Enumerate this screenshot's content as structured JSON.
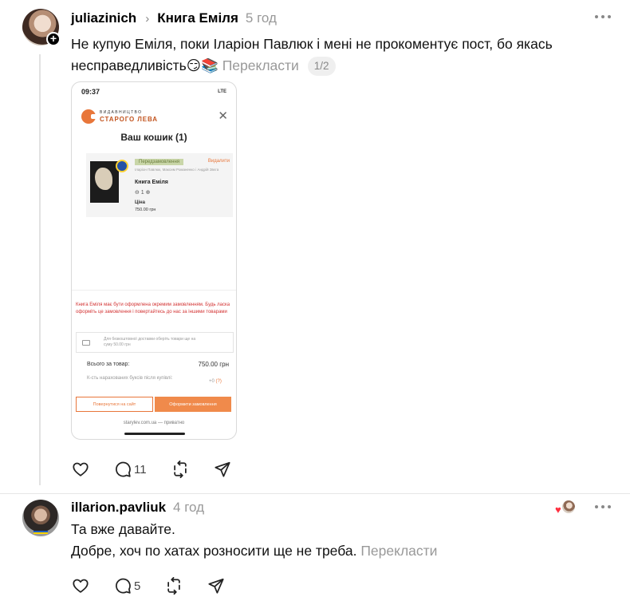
{
  "post1": {
    "username": "juliazinich",
    "topic": "Книга Еміля",
    "time": "5 год",
    "text": "Не купую Еміля, поки Іларіон Павлюк і мені не прокоментує пост, бо якась несправедливість😏📚",
    "translate": "Перекласти",
    "pager": "1/2",
    "replies": "11",
    "screenshot": {
      "status_time": "09:37",
      "status_right": "LTE",
      "brand_top": "ВИДАВНИЦТВО",
      "brand_bottom": "СТАРОГО ЛЕВА",
      "cart_title": "Ваш кошик (1)",
      "tag": "Передзамовлення",
      "delete": "Видалити",
      "authors": "Іларіон Павлюк, Максим Романенко і Андрій Звєга",
      "book": "Книга Еміля",
      "qty": "⊖ 1 ⊕",
      "price_label": "Ціна",
      "price": "750.00 грн",
      "warning": "Книга Еміля має бути оформлена окремим замовленням. Будь ласка оформіть це замовлення і повертайтесь до нас за іншими товарами",
      "delivery": "Для безкоштовної доставки оберіть товари ще на суму 50.00 грн",
      "total_label": "Всього за товар:",
      "total": "750.00 грн",
      "bonus_label": "К-сть нарахованих буксів після купівлі:",
      "bonus_value": "+0",
      "bonus_help": "(?)",
      "back_button": "Повернутися на сайт",
      "order_button": "Оформити замовлення",
      "url": "starylev.com.ua — приватно"
    }
  },
  "post2": {
    "username": "illarion.pavliuk",
    "time": "4 год",
    "line1": "Та вже давайте.",
    "line2": "Добре, хоч по хатах розносити ще не треба.",
    "translate": "Перекласти",
    "replies": "5"
  },
  "icons": [
    "heart-icon",
    "comment-icon",
    "repost-icon",
    "share-icon",
    "more-icon",
    "plus-icon",
    "chevron-right-icon",
    "close-icon",
    "truck-icon"
  ],
  "colors": {
    "accent": "#e8763a",
    "like": "#ff3040",
    "warning": "#d33333",
    "muted": "#999999"
  }
}
